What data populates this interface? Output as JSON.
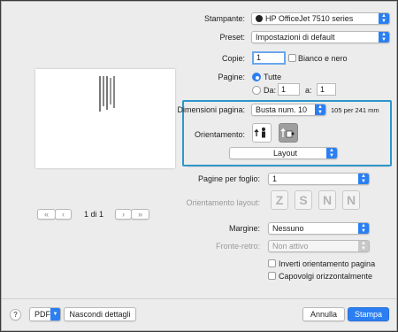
{
  "printer": {
    "label": "Stampante:",
    "value": "HP OfficeJet 7510 series"
  },
  "preset": {
    "label": "Preset:",
    "value": "Impostazioni di default"
  },
  "copies": {
    "label": "Copie:",
    "value": "1",
    "bw_label": "Bianco e nero"
  },
  "pages": {
    "label": "Pagine:",
    "all_label": "Tutte",
    "from_label": "Da:",
    "from_value": "1",
    "to_label": "a:",
    "to_value": "1"
  },
  "paper_size": {
    "label": "Dimensioni pagina:",
    "value": "Busta num. 10",
    "dimensions": "105 per 241 mm"
  },
  "orientation": {
    "label": "Orientamento:"
  },
  "section": {
    "value": "Layout"
  },
  "layout": {
    "pages_per_sheet_label": "Pagine per foglio:",
    "pages_per_sheet_value": "1",
    "layout_direction_label": "Orientamento layout:",
    "border_label": "Margine:",
    "border_value": "Nessuno",
    "two_sided_label": "Fronte-retro:",
    "two_sided_value": "Non attivo",
    "reverse_label": "Inverti orientamento pagina",
    "flip_label": "Capovolgi orizzontalmente"
  },
  "preview": {
    "page_counter": "1 di 1",
    "first_glyph": "«",
    "prev_glyph": "‹",
    "next_glyph": "›",
    "last_glyph": "»"
  },
  "footer": {
    "help_glyph": "?",
    "pdf_label": "PDF",
    "details_label": "Nascondi dettagli",
    "cancel_label": "Annulla",
    "print_label": "Stampa"
  },
  "colors": {
    "accent": "#2b7ff2",
    "highlight_border": "#2e96c9",
    "background": "#ececec"
  }
}
